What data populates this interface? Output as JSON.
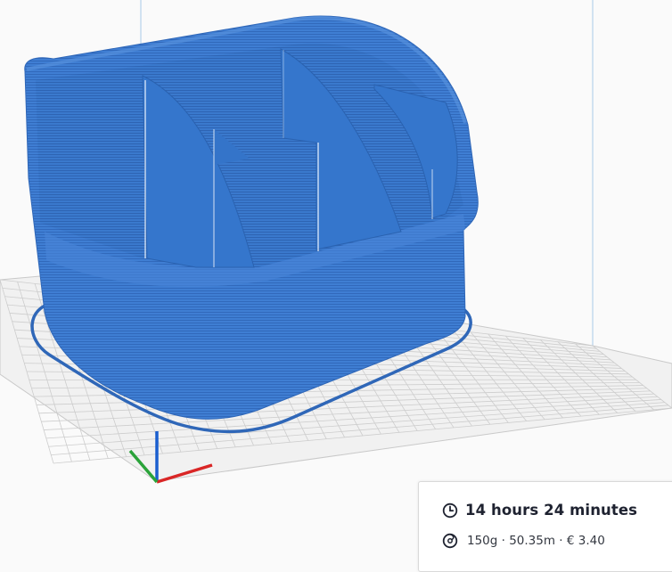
{
  "print_info": {
    "time_icon": "clock-icon",
    "print_time": "14 hours 24 minutes",
    "material_icon": "spool-icon",
    "material_summary": "150g · 50.35m · € 3.40"
  },
  "colors": {
    "model": "#3f7ed3",
    "model_shadow": "#2f67b8",
    "background": "#fafafa",
    "build_plate": "#f1f1f1",
    "grid_line": "#c9c9c9",
    "build_volume_line": "#a8cbe8",
    "axis_x": "#d92626",
    "axis_y": "#2aa33a",
    "axis_z": "#1b5fcf",
    "panel_text": "#1e2230"
  }
}
